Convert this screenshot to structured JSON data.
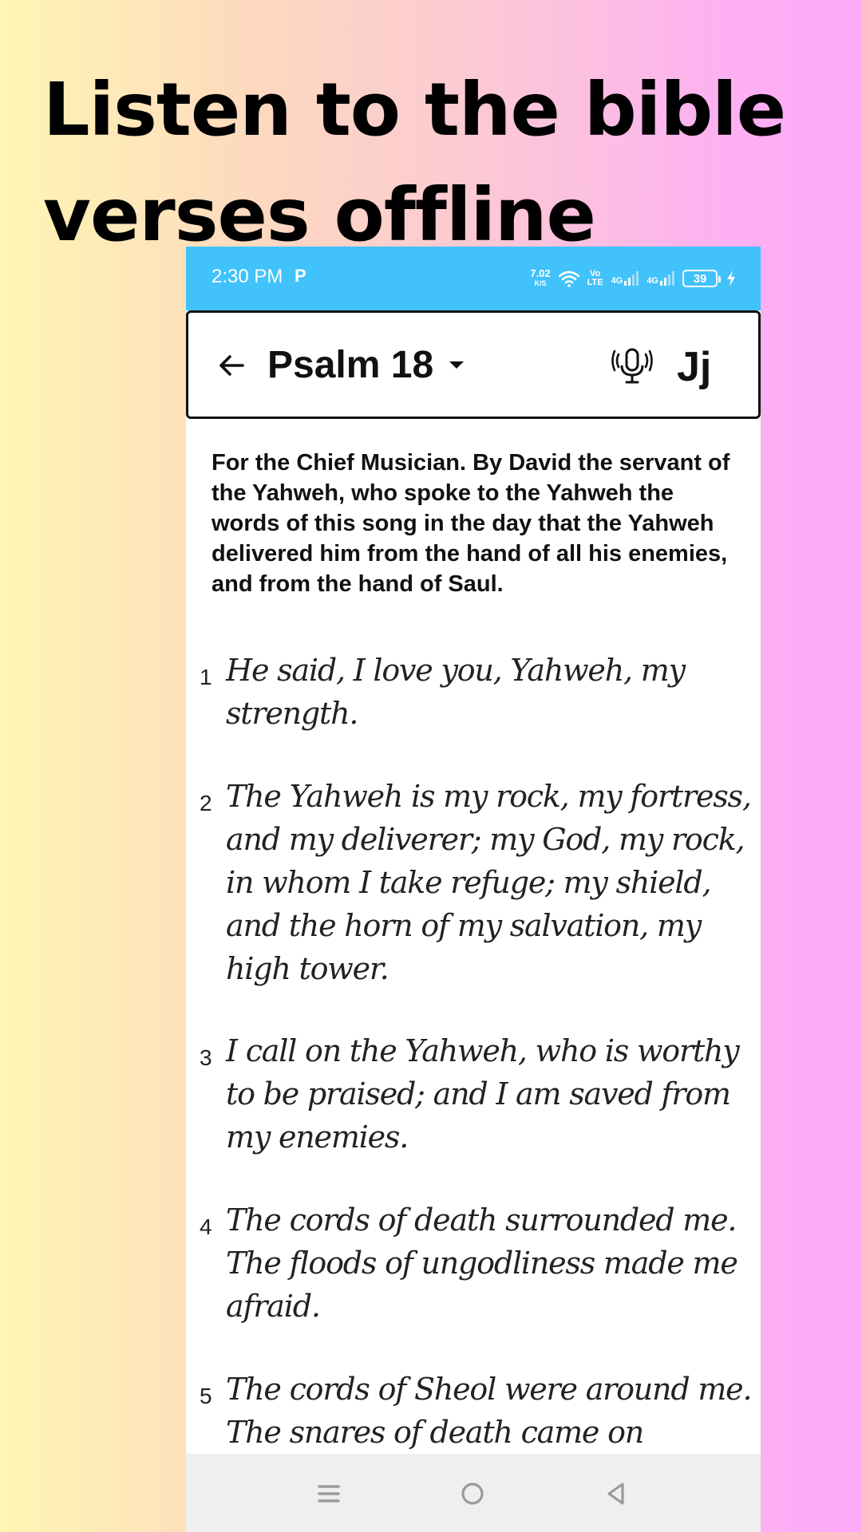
{
  "headline": "Listen to the bible verses offline",
  "status_bar": {
    "time": "2:30 PM",
    "app_indicator": "P",
    "speed_value": "7.02",
    "speed_unit": "K/S",
    "volte_top": "Vo",
    "volte_bottom": "LTE",
    "net1": "4G",
    "net2": "4G",
    "battery": "39",
    "background": "#41c2fb"
  },
  "app_bar": {
    "book_title": "Psalm 18",
    "font_button": "Jj",
    "icons": [
      "back-arrow-icon",
      "dropdown-arrow-icon",
      "microphone-icon"
    ]
  },
  "chapter": {
    "superscription": "For the Chief Musician. By David the servant of the Yahweh, who spoke to the Yahweh the words of this song in the day that the Yahweh delivered him from the hand of all his enemies, and from the hand of Saul.",
    "verses": [
      {
        "number": "1",
        "text": "He said, I love you, Yahweh, my strength."
      },
      {
        "number": "2",
        "text": "The Yahweh is my rock, my fortress, and my deliverer; my God, my rock, in whom I take refuge; my shield, and the horn of my salvation, my high tower."
      },
      {
        "number": "3",
        "text": "I call on the Yahweh, who is worthy to be praised; and I am saved from my enemies."
      },
      {
        "number": "4",
        "text": "The cords of death surrounded me. The floods of ungodliness made me afraid."
      },
      {
        "number": "5",
        "text": "The cords of Sheol were around me. The snares of death came on"
      }
    ]
  },
  "nav_bar": {
    "icons": [
      "menu-icon",
      "home-icon",
      "back-icon"
    ]
  }
}
